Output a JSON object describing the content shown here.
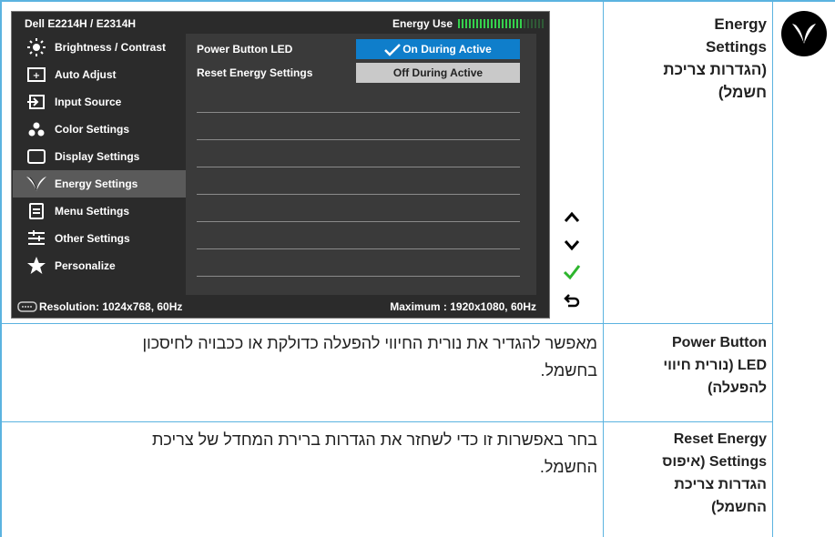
{
  "osd": {
    "title": "Dell E2214H / E2314H",
    "energy_label": "Energy Use",
    "energy_level": 0.75,
    "menu": [
      {
        "label": "Brightness / Contrast",
        "icon": "brightness-icon"
      },
      {
        "label": "Auto Adjust",
        "icon": "auto-adjust-icon"
      },
      {
        "label": "Input Source",
        "icon": "input-source-icon"
      },
      {
        "label": "Color Settings",
        "icon": "color-settings-icon"
      },
      {
        "label": "Display Settings",
        "icon": "display-settings-icon"
      },
      {
        "label": "Energy Settings",
        "icon": "leaf-icon"
      },
      {
        "label": "Menu Settings",
        "icon": "menu-settings-icon"
      },
      {
        "label": "Other Settings",
        "icon": "other-settings-icon"
      },
      {
        "label": "Personalize",
        "icon": "star-icon"
      }
    ],
    "submenu": [
      {
        "label": "Power Button LED",
        "value": "On During Active"
      },
      {
        "label": "Reset Energy Settings",
        "value": "Off During Active"
      }
    ],
    "resolution": "Resolution: 1024x768,  60Hz",
    "maximum": "Maximum : 1920x1080,  60Hz",
    "accent": "#0f7ecb"
  },
  "nav": [
    "up-icon",
    "down-icon",
    "check-icon",
    "back-icon"
  ],
  "doc": {
    "heading": {
      "line1": "Energy",
      "line2": "Settings",
      "line3": "(הגדרות צריכת",
      "line4": "חשמל)"
    },
    "rows": [
      {
        "term1": "Power Button",
        "term2": "LED (נורית חיווי",
        "term3": "להפעלה)",
        "desc1": "מאפשר להגדיר את נורית החיווי להפעלה כדולקת או ככבויה לחיסכון",
        "desc2": "בחשמל."
      },
      {
        "term1": "Reset Energy",
        "term2": "Settings (איפוס",
        "term3": "הגדרות צריכת",
        "term4": "החשמל)",
        "desc1": "בחר באפשרות זו כדי לשחזר את הגדרות ברירת המחדל של צריכת",
        "desc2": "החשמל."
      }
    ]
  }
}
